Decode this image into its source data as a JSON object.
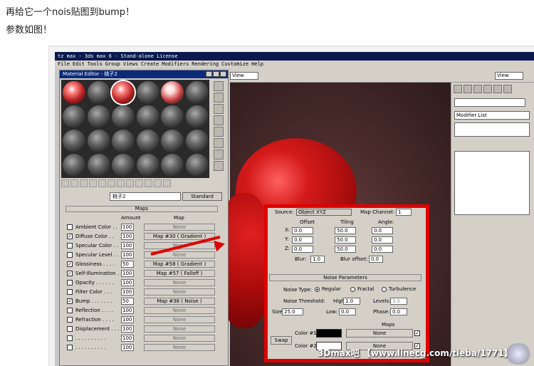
{
  "post": {
    "line1": "再给它一个nois贴图到bump！",
    "line2": "参数如图！"
  },
  "app": {
    "title": "tz max - 3ds max 6 - Stand-alone License",
    "menu": [
      "File",
      "Edit",
      "Tools",
      "Group",
      "Views",
      "Create",
      "Modifiers",
      "Rendering",
      "Customize",
      "Help"
    ],
    "view_select_left": "View",
    "view_select_right": "View",
    "modifier_list": "Modifier List"
  },
  "material_editor": {
    "title": "Material Editor - 桃子2",
    "material_name": "桃子2",
    "standard_button": "Standard",
    "maps_header": "Maps",
    "col_amount": "Amount",
    "col_map": "Map",
    "rows": [
      {
        "label": "Ambient Color . .",
        "checked": false,
        "amount": "100",
        "map": "None"
      },
      {
        "label": "Diffuse Color . .",
        "checked": true,
        "amount": "100",
        "map": "Map #30  ( Gradient )"
      },
      {
        "label": "Specular Color . .",
        "checked": false,
        "amount": "100",
        "map": "None"
      },
      {
        "label": "Specular Level . .",
        "checked": false,
        "amount": "100",
        "map": "None"
      },
      {
        "label": "Glossiness . . . .",
        "checked": true,
        "amount": "50",
        "map": "Map #58  ( Gradient )"
      },
      {
        "label": "Self-Illumination .",
        "checked": true,
        "amount": "100",
        "map": "Map #57  ( Falloff )"
      },
      {
        "label": "Opacity . . . . . .",
        "checked": false,
        "amount": "100",
        "map": "None"
      },
      {
        "label": "Filter Color . . .",
        "checked": false,
        "amount": "100",
        "map": "None"
      },
      {
        "label": "Bump . . . . . . .",
        "checked": true,
        "amount": "50",
        "map": "Map #38  ( Noise )"
      },
      {
        "label": "Reflection . . . .",
        "checked": false,
        "amount": "100",
        "map": "None"
      },
      {
        "label": "Refraction . . . .",
        "checked": false,
        "amount": "100",
        "map": "None"
      },
      {
        "label": "Displacement . . .",
        "checked": false,
        "amount": "100",
        "map": "None"
      },
      {
        "label": ". . . . . . . . . .",
        "checked": false,
        "amount": "100",
        "map": "None"
      },
      {
        "label": ". . . . . . . . . .",
        "checked": false,
        "amount": "100",
        "map": "None"
      }
    ]
  },
  "noise_panel": {
    "source_label": "Source:",
    "source_value": "Object XYZ",
    "map_channel_label": "Map Channel:",
    "map_channel_value": "1",
    "offset_label": "Offset",
    "tiling_label": "Tiling",
    "angle_label": "Angle:",
    "axes": [
      {
        "axis": "X:",
        "offset": "0.0",
        "tiling": "50.0",
        "angle": "0.0"
      },
      {
        "axis": "Y:",
        "offset": "0.0",
        "tiling": "50.0",
        "angle": "0.0"
      },
      {
        "axis": "Z:",
        "offset": "0.0",
        "tiling": "50.0",
        "angle": "0.0"
      }
    ],
    "blur_label": "Blur:",
    "blur_value": "1.0",
    "blur_offset_label": "Blur offset:",
    "blur_offset_value": "0.0",
    "noise_params_header": "Noise Parameters",
    "noise_type_label": "Noise Type:",
    "type_regular": "Regular",
    "type_fractal": "Fractal",
    "type_turbulence": "Turbulence",
    "threshold_label": "Noise Threshold:",
    "high_label": "High:",
    "high_value": "1.0",
    "levels_label": "Levels:",
    "levels_value": "3.0",
    "size_label": "Size:",
    "size_value": "25.0",
    "low_label": "Low:",
    "low_value": "0.0",
    "phase_label": "Phase:",
    "phase_value": "0.0",
    "maps_label": "Maps",
    "color1_label": "Color #1",
    "color2_label": "Color #2",
    "color1": "#000000",
    "color2": "#ffffff",
    "none1": "None",
    "none2": "None",
    "swap_label": "Swap"
  },
  "watermark": "3Dmax吧 【www.linecg.com/tieba/1771】",
  "colors": {
    "highlight": "#e00000",
    "titlebar": "#0a1a4e"
  }
}
